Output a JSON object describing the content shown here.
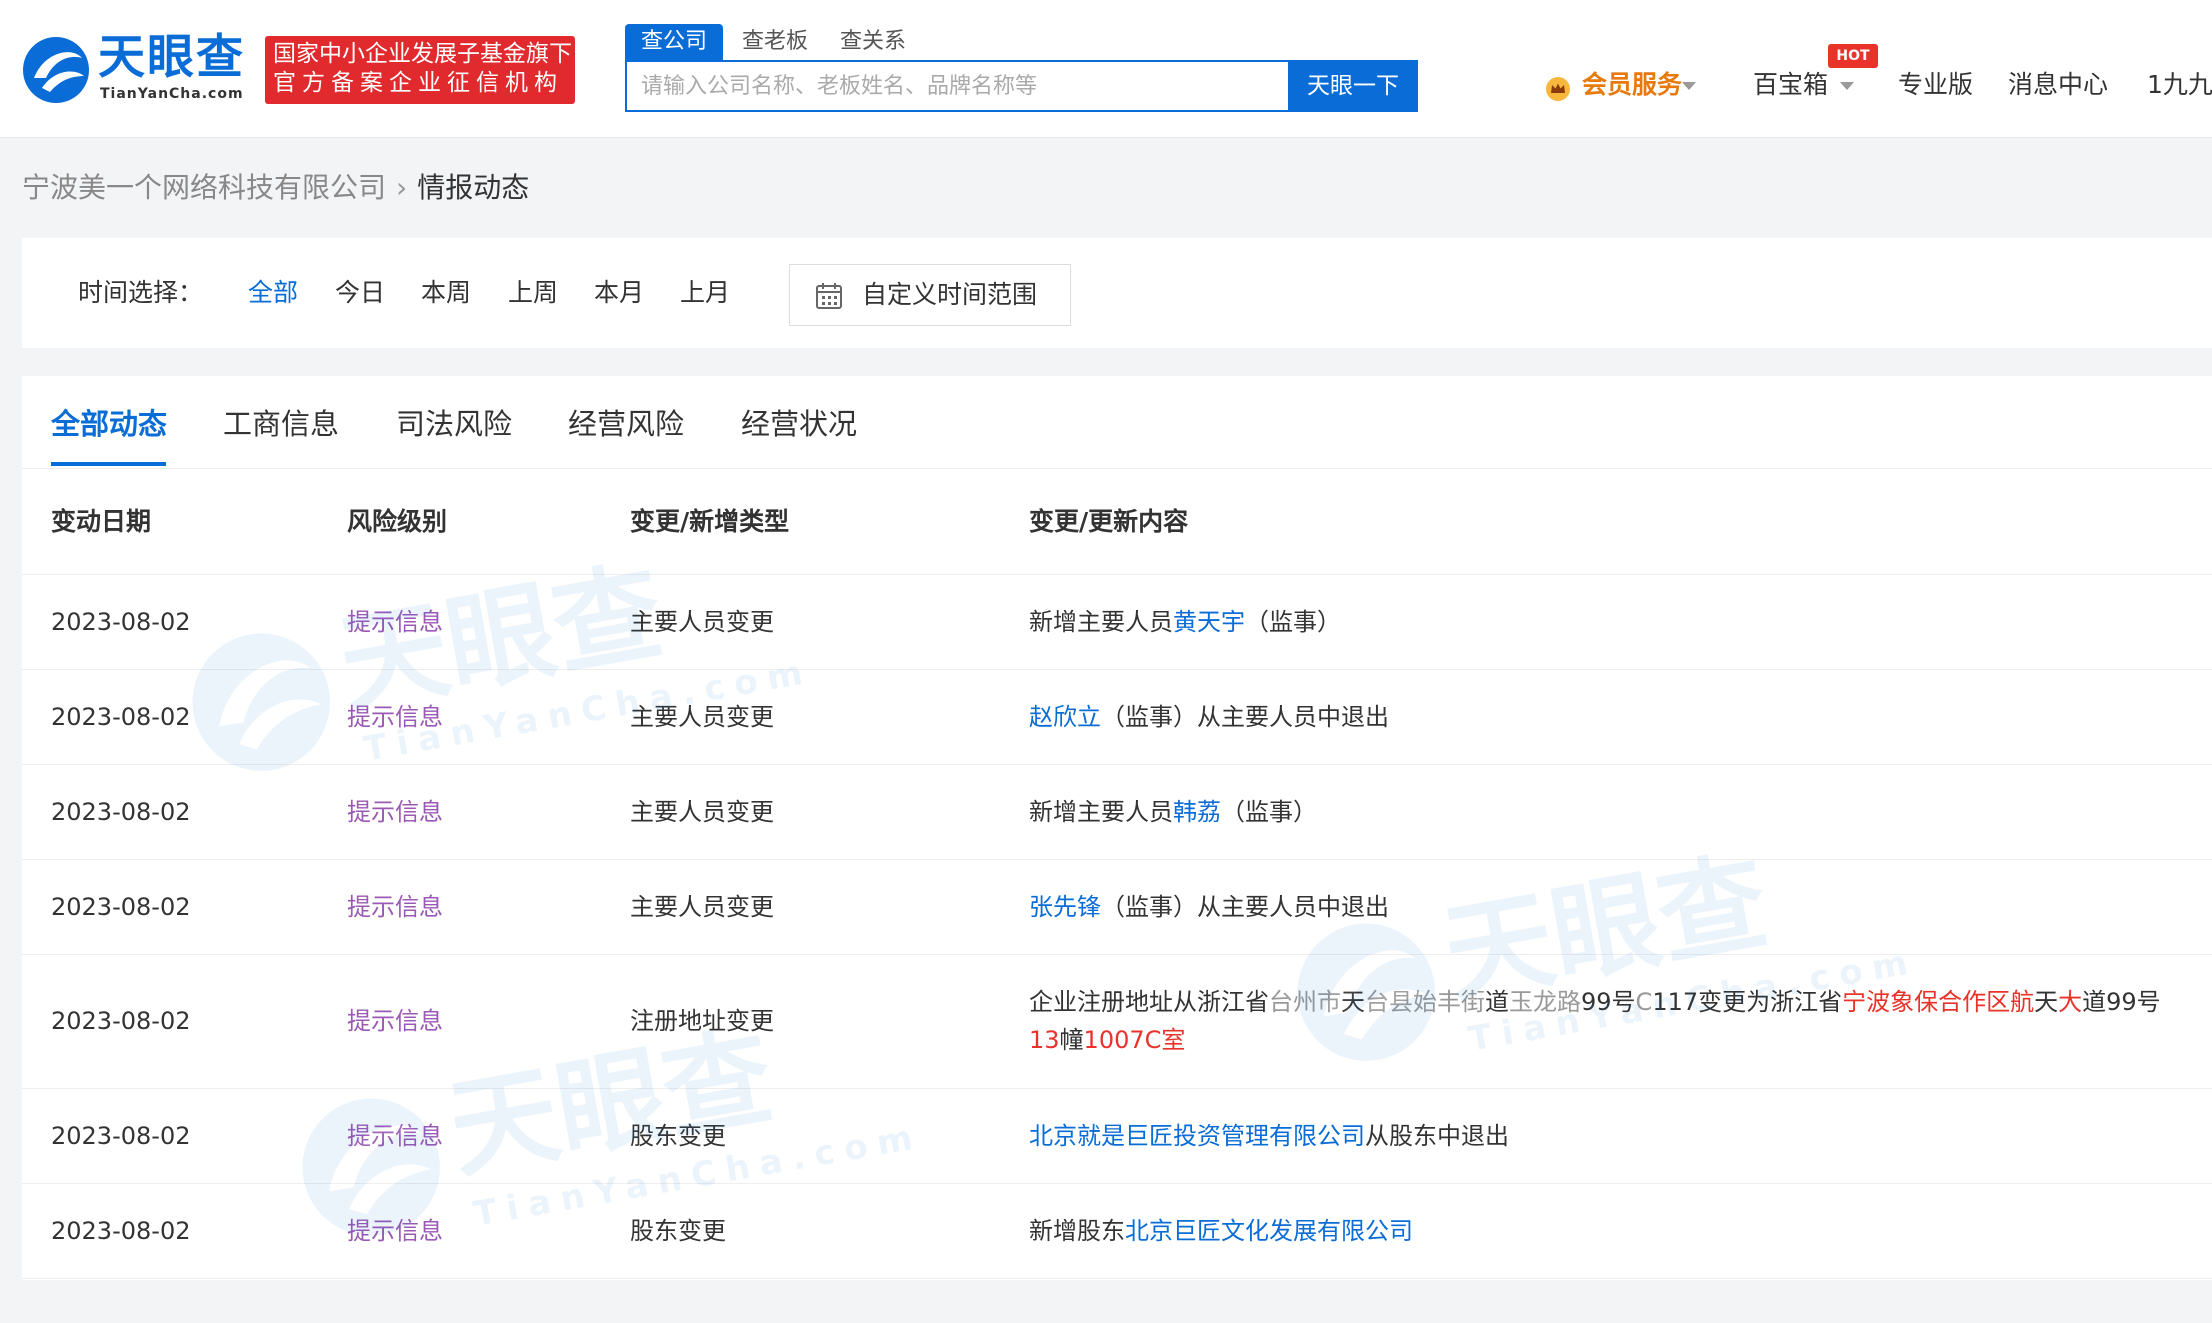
{
  "header": {
    "logo_text": "天眼查",
    "logo_en": "TianYanCha.com",
    "badge_line1": "国家中小企业发展子基金旗下",
    "badge_line2": "官方备案企业征信机构",
    "search_tabs": [
      "查公司",
      "查老板",
      "查关系"
    ],
    "search_placeholder": "请输入公司名称、老板姓名、品牌名称等",
    "search_button": "天眼一下",
    "nav": {
      "vip": "会员服务",
      "toolbox": "百宝箱",
      "hot": "HOT",
      "pro": "专业版",
      "messages": "消息中心",
      "user": "1九九"
    }
  },
  "breadcrumb": {
    "company": "宁波美一个网络科技有限公司",
    "separator": "›",
    "current": "情报动态"
  },
  "time_filter": {
    "label": "时间选择：",
    "options": [
      "全部",
      "今日",
      "本周",
      "上周",
      "本月",
      "上月"
    ],
    "selected": "全部",
    "custom": "自定义时间范围"
  },
  "tabs": [
    "全部动态",
    "工商信息",
    "司法风险",
    "经营风险",
    "经营状况"
  ],
  "table": {
    "headers": [
      "变动日期",
      "风险级别",
      "变更/新增类型",
      "变更/更新内容"
    ],
    "rows": [
      {
        "date": "2023-08-02",
        "risk": "提示信息",
        "type": "主要人员变更",
        "c_pre": "新增主要人员",
        "c_link": "黄天宇",
        "c_post": "（监事）"
      },
      {
        "date": "2023-08-02",
        "risk": "提示信息",
        "type": "主要人员变更",
        "c_link": "赵欣立",
        "c_post": "（监事）从主要人员中退出"
      },
      {
        "date": "2023-08-02",
        "risk": "提示信息",
        "type": "主要人员变更",
        "c_pre": "新增主要人员",
        "c_link": "韩荔",
        "c_post": "（监事）"
      },
      {
        "date": "2023-08-02",
        "risk": "提示信息",
        "type": "主要人员变更",
        "c_link": "张先锋",
        "c_post": "（监事）从主要人员中退出"
      },
      {
        "date": "2023-08-02",
        "risk": "提示信息",
        "type": "注册地址变更",
        "addr": {
          "p1": "企业注册地址从浙江省",
          "g1": "台州市",
          "p2": "天",
          "g2": "台县始丰街",
          "p3": "道",
          "g3": "玉龙路",
          "p4": "99号",
          "g4": "C",
          "p5": "117变更为浙江省",
          "r1": "宁波象保合作区航",
          "p6": "天",
          "r2": "大",
          "p7": "道99号",
          "r3": "13",
          "p8": "幢",
          "r4": "1007C室"
        }
      },
      {
        "date": "2023-08-02",
        "risk": "提示信息",
        "type": "股东变更",
        "c_link": "北京就是巨匠投资管理有限公司",
        "c_post": "从股东中退出"
      },
      {
        "date": "2023-08-02",
        "risk": "提示信息",
        "type": "股东变更",
        "c_pre": "新增股东",
        "c_link": "北京巨匠文化发展有限公司"
      }
    ]
  },
  "colors": {
    "brand": "#0a6cd6",
    "risk": "#9b59b6",
    "badge": "#e12a2e",
    "vip": "#e8790c"
  }
}
